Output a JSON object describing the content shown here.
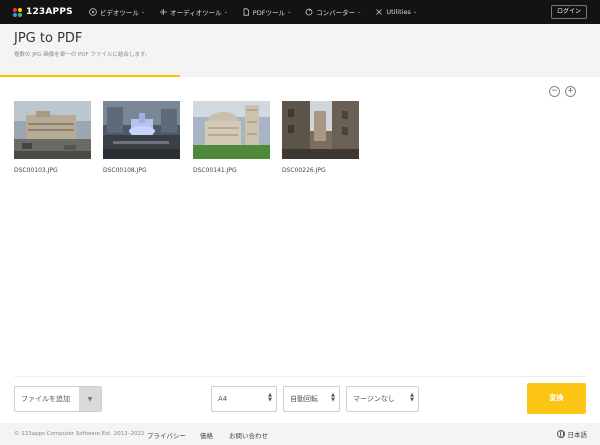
{
  "nav": {
    "logo_text": "123APPS",
    "items": [
      {
        "label": "ビデオツール",
        "icon": "play-icon"
      },
      {
        "label": "オーディオツール",
        "icon": "waveform-icon"
      },
      {
        "label": "PDFツール",
        "icon": "document-icon"
      },
      {
        "label": "コンバーター",
        "icon": "convert-icon"
      },
      {
        "label": "Utilities",
        "icon": "tools-icon"
      }
    ],
    "login_label": "ログイン"
  },
  "header": {
    "title": "JPG to PDF",
    "subtitle": "複数の JPG 画像を単一の PDF ファイルに結合します。",
    "accent_color": "#f7c400"
  },
  "zoom": {
    "out_label": "−",
    "in_label": "+"
  },
  "files": [
    {
      "name": "DSC00103.JPG"
    },
    {
      "name": "DSC00108.JPG"
    },
    {
      "name": "DSC00141.JPG"
    },
    {
      "name": "DSC00226.JPG"
    }
  ],
  "toolbar": {
    "add_files_label": "ファイルを追加",
    "page_size": "A4",
    "orientation": "自動回転",
    "margin": "マージンなし",
    "convert_label": "変換"
  },
  "footer": {
    "copyright": "© 123apps Computer Software Est. 2012–2022",
    "links": [
      "プライバシー",
      "価格",
      "お問い合わせ"
    ],
    "language": "日本語"
  }
}
